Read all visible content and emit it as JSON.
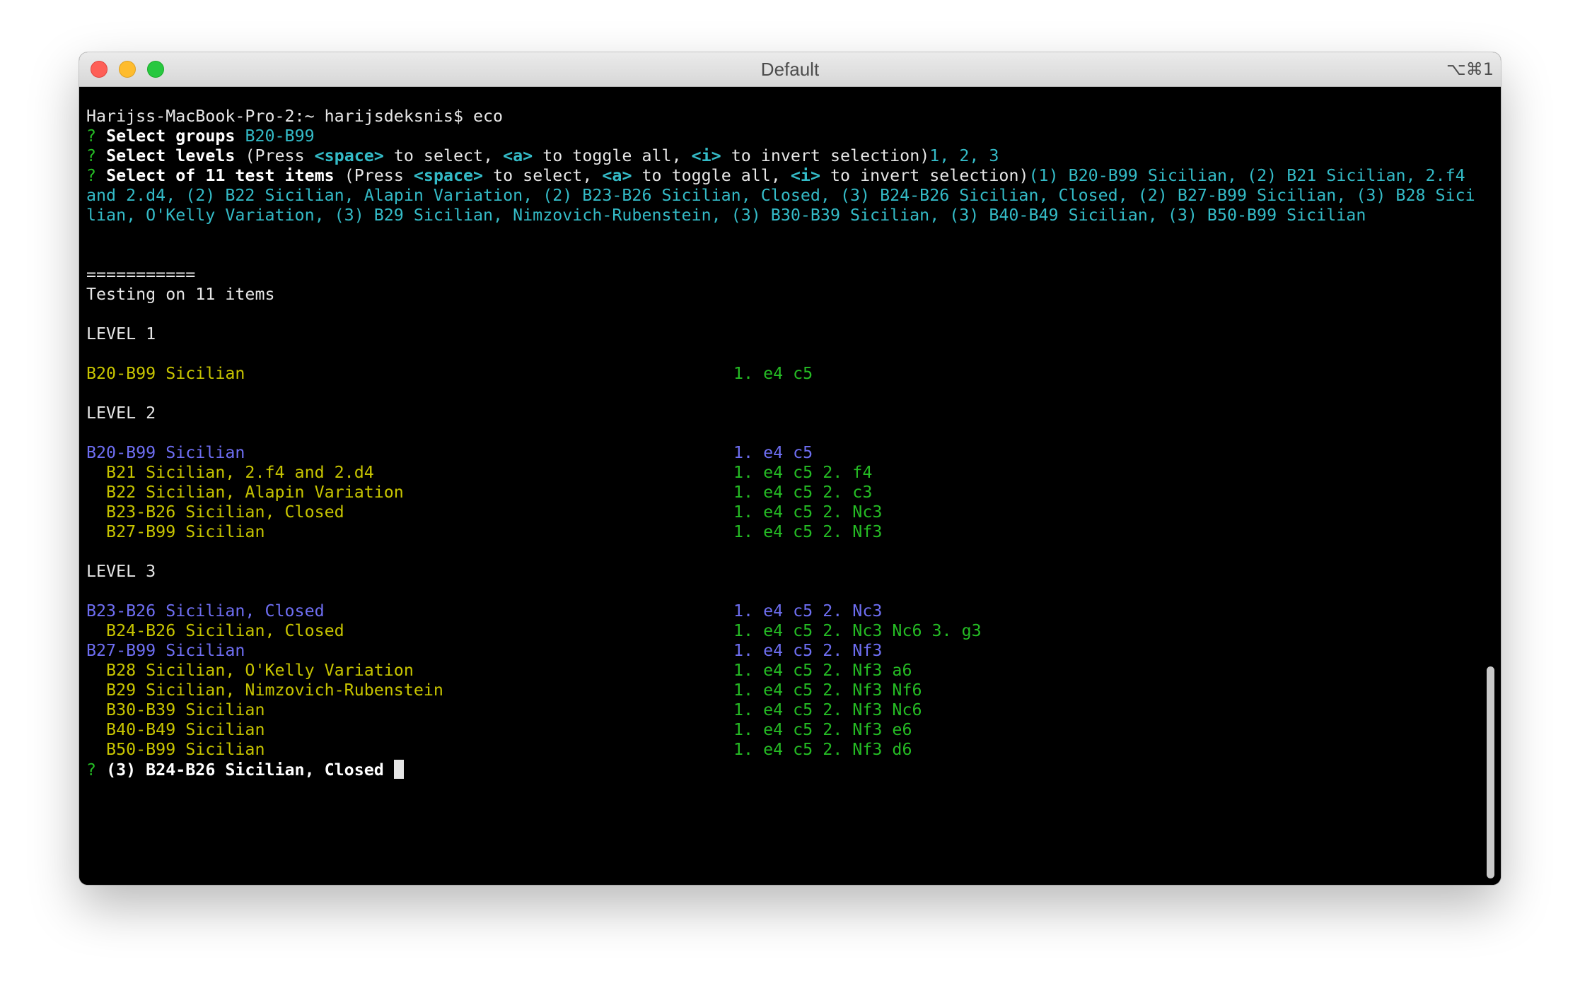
{
  "window": {
    "title": "Default",
    "shortcut": "⌥⌘1"
  },
  "prompt": {
    "line": "Harijss-MacBook-Pro-2:~ harijsdeksnis$ eco"
  },
  "questions": {
    "mark": "?",
    "groups_label": "Select groups",
    "groups_value": "B20-B99",
    "levels_label": "Select levels",
    "press_pre": "(Press ",
    "space_key": "<space>",
    "to_select": " to select, ",
    "a_key": "<a>",
    "to_toggle": " to toggle all, ",
    "i_key": "<i>",
    "to_invert": " to invert selection)",
    "levels_value": "1, 2, 3",
    "items_label": "Select of 11 test items",
    "items_value_line1": "(1) B20-B99 Sicilian, (2) B21 Sicilian, 2.f4",
    "items_value_line2": "and 2.d4, (2) B22 Sicilian, Alapin Variation, (2) B23-B26 Sicilian, Closed, (3) B24-B26 Sicilian, Closed, (2) B27-B99 Sicilian, (3) B28 Sici",
    "items_value_line3": "lian, O'Kelly Variation, (3) B29 Sicilian, Nimzovich-Rubenstein, (3) B30-B39 Sicilian, (3) B40-B49 Sicilian, (3) B50-B99 Sicilian"
  },
  "output": {
    "separator": "===========",
    "testing": "Testing on 11 items",
    "level1": {
      "heading": "LEVEL 1",
      "rows": [
        {
          "name": "B20-B99 Sicilian",
          "moves": "1. e4 c5"
        }
      ]
    },
    "level2": {
      "heading": "LEVEL 2",
      "parent": {
        "name": "B20-B99 Sicilian",
        "moves": "1. e4 c5"
      },
      "rows": [
        {
          "name": "  B21 Sicilian, 2.f4 and 2.d4",
          "moves": "1. e4 c5 2. f4"
        },
        {
          "name": "  B22 Sicilian, Alapin Variation",
          "moves": "1. e4 c5 2. c3"
        },
        {
          "name": "  B23-B26 Sicilian, Closed",
          "moves": "1. e4 c5 2. Nc3"
        },
        {
          "name": "  B27-B99 Sicilian",
          "moves": "1. e4 c5 2. Nf3"
        }
      ]
    },
    "level3": {
      "heading": "LEVEL 3",
      "parent1": {
        "name": "B23-B26 Sicilian, Closed",
        "moves": "1. e4 c5 2. Nc3"
      },
      "rows1": [
        {
          "name": "  B24-B26 Sicilian, Closed",
          "moves": "1. e4 c5 2. Nc3 Nc6 3. g3"
        }
      ],
      "parent2": {
        "name": "B27-B99 Sicilian",
        "moves": "1. e4 c5 2. Nf3"
      },
      "rows2": [
        {
          "name": "  B28 Sicilian, O'Kelly Variation",
          "moves": "1. e4 c5 2. Nf3 a6"
        },
        {
          "name": "  B29 Sicilian, Nimzovich-Rubenstein",
          "moves": "1. e4 c5 2. Nf3 Nf6"
        },
        {
          "name": "  B30-B39 Sicilian",
          "moves": "1. e4 c5 2. Nf3 Nc6"
        },
        {
          "name": "  B40-B49 Sicilian",
          "moves": "1. e4 c5 2. Nf3 e6"
        },
        {
          "name": "  B50-B99 Sicilian",
          "moves": "1. e4 c5 2. Nf3 d6"
        }
      ]
    },
    "current_question": "(3) B24-B26 Sicilian, Closed"
  },
  "colors": {
    "cyan": "#34bbc7",
    "green": "#25bc24",
    "yellow": "#c7c400",
    "blue": "#6e6ef2",
    "background": "#000000"
  }
}
